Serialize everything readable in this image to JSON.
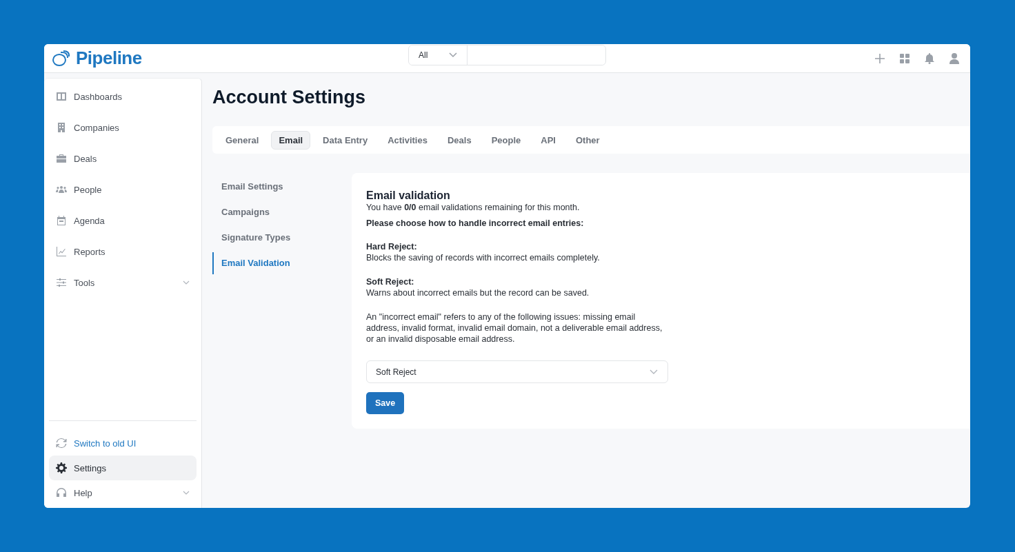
{
  "app": {
    "logo": "Pipeline"
  },
  "search": {
    "scope": "All"
  },
  "sidebar": {
    "items": [
      {
        "label": "Dashboards",
        "kind": "link",
        "selected": false
      },
      {
        "label": "Companies",
        "kind": "link",
        "selected": false
      },
      {
        "label": "Deals",
        "kind": "link",
        "selected": false
      },
      {
        "label": "People",
        "kind": "link",
        "selected": false
      },
      {
        "label": "Agenda",
        "kind": "link",
        "selected": false
      },
      {
        "label": "Reports",
        "kind": "link",
        "selected": false
      },
      {
        "label": "Tools",
        "kind": "group",
        "selected": false
      }
    ],
    "footer_items": [
      {
        "label": "Switch to old UI",
        "kind": "action",
        "selected": false
      },
      {
        "label": "Settings",
        "kind": "link",
        "selected": true
      },
      {
        "label": "Help",
        "kind": "group",
        "selected": false
      }
    ]
  },
  "page": {
    "title": "Account Settings"
  },
  "tabs": [
    {
      "label": "General",
      "selected": false
    },
    {
      "label": "Email",
      "selected": true
    },
    {
      "label": "Data Entry",
      "selected": false
    },
    {
      "label": "Activities",
      "selected": false
    },
    {
      "label": "Deals",
      "selected": false
    },
    {
      "label": "People",
      "selected": false
    },
    {
      "label": "API",
      "selected": false
    },
    {
      "label": "Other",
      "selected": false
    }
  ],
  "subnav": [
    {
      "label": "Email Settings",
      "selected": false
    },
    {
      "label": "Campaigns",
      "selected": false
    },
    {
      "label": "Signature Types",
      "selected": false
    },
    {
      "label": "Email Validation",
      "selected": true
    }
  ],
  "card": {
    "title": "Email validation",
    "remaining": "You have **0/0** email validations remaining for this month.",
    "prompt": "Please choose how to handle incorrect email entries:",
    "options": [
      {
        "term": "Hard Reject:",
        "description": "Blocks the saving of records with incorrect emails completely."
      },
      {
        "term": "Soft Reject:",
        "description": "Warns about incorrect emails but the record can be saved."
      }
    ],
    "note": "An \"incorrect email\" refers to any of the following issues: missing email address, invalid format, invalid email domain, not a deliverable email address, or an invalid disposable email address.",
    "select_value": "Soft Reject",
    "save_button": "Save"
  }
}
